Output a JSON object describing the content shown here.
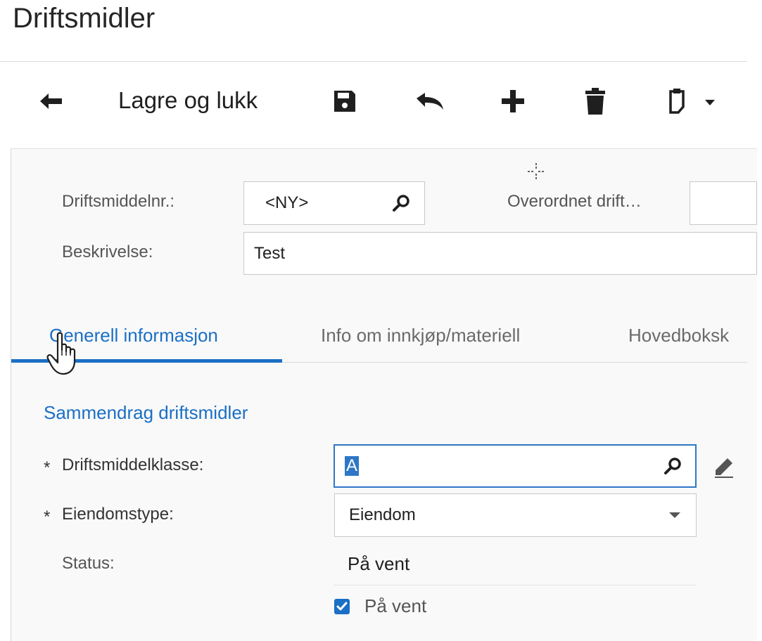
{
  "page": {
    "title": "Driftsmidler"
  },
  "toolbar": {
    "back_icon": "arrow-left-icon",
    "save_close_label": "Lagre og lukk",
    "save_icon": "floppy-disk-icon",
    "undo_icon": "undo-icon",
    "add_icon": "plus-icon",
    "delete_icon": "trash-icon",
    "clipboard_icon": "clipboard-dropdown-icon"
  },
  "header_form": {
    "asset_no_label": "Driftsmiddelnr.:",
    "asset_no_value": "<NY>",
    "parent_label": "Overordnet drift…",
    "parent_value": "",
    "description_label": "Beskrivelse:",
    "description_value": "Test"
  },
  "tabs": [
    {
      "label": "Generell informasjon",
      "active": true
    },
    {
      "label": "Info om innkjøp/materiell",
      "active": false
    },
    {
      "label": "Hovedboksk",
      "active": false
    }
  ],
  "section": {
    "title": "Sammendrag driftsmidler",
    "required_mark": "*",
    "class_label": "Driftsmiddelklasse:",
    "class_value": "A",
    "property_type_label": "Eiendomstype:",
    "property_type_value": "Eiendom",
    "status_label": "Status:",
    "status_value": "På vent",
    "on_hold_label": "På vent",
    "on_hold_checked": true
  },
  "colors": {
    "accent": "#1b6fc4",
    "panel_bg": "#f9f9fa",
    "focus_border": "#2e77c6"
  }
}
